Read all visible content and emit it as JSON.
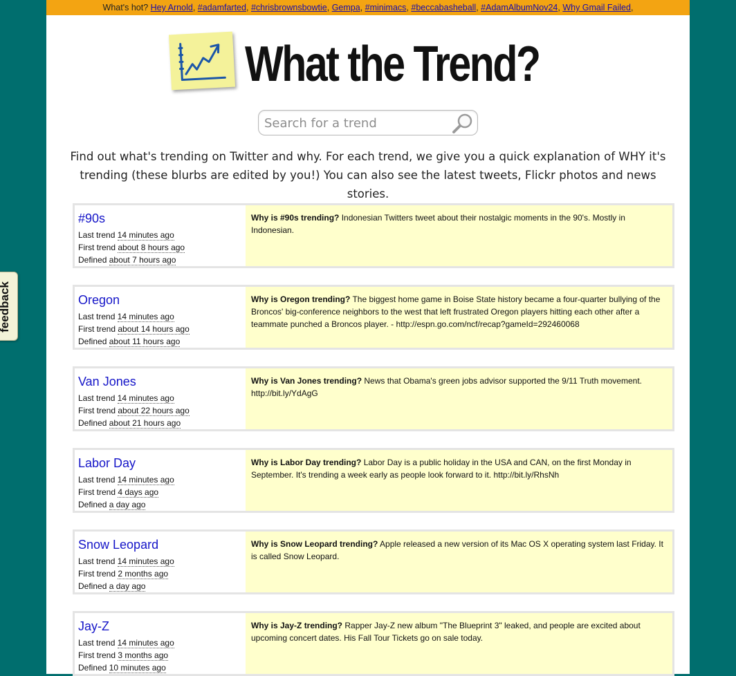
{
  "hotbar": {
    "prefix": "What's hot?",
    "links": [
      "Hey Arnold",
      "#adamfarted",
      "#chrisbrownsbowtie",
      "Gempa",
      "#minimacs",
      "#beccabasheball",
      "#AdamAlbumNov24",
      "Why Gmail Failed"
    ]
  },
  "logo": {
    "title": "What the Trend?",
    "icon": "trend-chart-icon"
  },
  "search": {
    "placeholder": "Search for a trend",
    "icon": "magnifier-icon"
  },
  "intro": "Find out what's trending on Twitter and why. For each trend, we give you a quick explanation of WHY it's trending (these blurbs are edited by you!) You can also see the latest tweets, Flickr photos and news stories.",
  "feedback": {
    "label": "feedback"
  },
  "trends": [
    {
      "name": "#90s",
      "last_label": "Last trend",
      "last": "14 minutes ago",
      "first_label": "First trend",
      "first": "about 8 hours ago",
      "defined_label": "Defined",
      "defined": "about 7 hours ago",
      "why": "Why is #90s trending?",
      "blurb": "Indonesian Twitters tweet about their nostalgic moments in the 90's. Mostly in Indonesian."
    },
    {
      "name": "Oregon",
      "last_label": "Last trend",
      "last": "14 minutes ago",
      "first_label": "First trend",
      "first": "about 14 hours ago",
      "defined_label": "Defined",
      "defined": "about 11 hours ago",
      "why": "Why is Oregon trending?",
      "blurb": "The biggest home game in Boise State history became a four-quarter bullying of the Broncos' big-conference neighbors to the west that left frustrated Oregon players hitting each other after a teammate punched a Broncos player. - http://espn.go.com/ncf/recap?gameId=292460068"
    },
    {
      "name": "Van Jones",
      "last_label": "Last trend",
      "last": "14 minutes ago",
      "first_label": "First trend",
      "first": "about 22 hours ago",
      "defined_label": "Defined",
      "defined": "about 21 hours ago",
      "why": "Why is Van Jones trending?",
      "blurb": "News that Obama's green jobs advisor supported the 9/11 Truth movement. http://bit.ly/YdAgG"
    },
    {
      "name": "Labor Day",
      "last_label": "Last trend",
      "last": "14 minutes ago",
      "first_label": "First trend",
      "first": "4 days ago",
      "defined_label": "Defined",
      "defined": "a day ago",
      "why": "Why is Labor Day trending?",
      "blurb": "Labor Day is a public holiday in the USA and CAN, on the first Monday in September. It's trending a week early as people look forward to it. http://bit.ly/RhsNh"
    },
    {
      "name": "Snow Leopard",
      "last_label": "Last trend",
      "last": "14 minutes ago",
      "first_label": "First trend",
      "first": "2 months ago",
      "defined_label": "Defined",
      "defined": "a day ago",
      "why": "Why is Snow Leopard trending?",
      "blurb": "Apple released a new version of its Mac OS X operating system last Friday. It is called Snow Leopard."
    },
    {
      "name": "Jay-Z",
      "last_label": "Last trend",
      "last": "14 minutes ago",
      "first_label": "First trend",
      "first": "3 months ago",
      "defined_label": "Defined",
      "defined": "10 minutes ago",
      "why": "Why is Jay-Z trending?",
      "blurb": "Rapper Jay-Z new album \"The Blueprint 3\" leaked, and people are excited about upcoming concert dates. His Fall Tour Tickets go on sale today."
    }
  ]
}
